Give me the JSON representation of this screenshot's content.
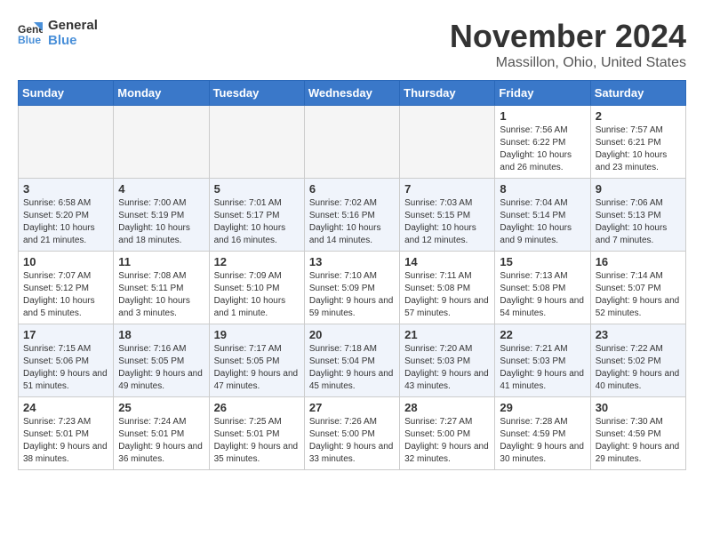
{
  "logo": {
    "line1": "General",
    "line2": "Blue"
  },
  "title": "November 2024",
  "location": "Massillon, Ohio, United States",
  "weekdays": [
    "Sunday",
    "Monday",
    "Tuesday",
    "Wednesday",
    "Thursday",
    "Friday",
    "Saturday"
  ],
  "weeks": [
    [
      {
        "day": "",
        "empty": true
      },
      {
        "day": "",
        "empty": true
      },
      {
        "day": "",
        "empty": true
      },
      {
        "day": "",
        "empty": true
      },
      {
        "day": "",
        "empty": true
      },
      {
        "day": "1",
        "info": "Sunrise: 7:56 AM\nSunset: 6:22 PM\nDaylight: 10 hours and 26 minutes."
      },
      {
        "day": "2",
        "info": "Sunrise: 7:57 AM\nSunset: 6:21 PM\nDaylight: 10 hours and 23 minutes."
      }
    ],
    [
      {
        "day": "3",
        "info": "Sunrise: 6:58 AM\nSunset: 5:20 PM\nDaylight: 10 hours and 21 minutes."
      },
      {
        "day": "4",
        "info": "Sunrise: 7:00 AM\nSunset: 5:19 PM\nDaylight: 10 hours and 18 minutes."
      },
      {
        "day": "5",
        "info": "Sunrise: 7:01 AM\nSunset: 5:17 PM\nDaylight: 10 hours and 16 minutes."
      },
      {
        "day": "6",
        "info": "Sunrise: 7:02 AM\nSunset: 5:16 PM\nDaylight: 10 hours and 14 minutes."
      },
      {
        "day": "7",
        "info": "Sunrise: 7:03 AM\nSunset: 5:15 PM\nDaylight: 10 hours and 12 minutes."
      },
      {
        "day": "8",
        "info": "Sunrise: 7:04 AM\nSunset: 5:14 PM\nDaylight: 10 hours and 9 minutes."
      },
      {
        "day": "9",
        "info": "Sunrise: 7:06 AM\nSunset: 5:13 PM\nDaylight: 10 hours and 7 minutes."
      }
    ],
    [
      {
        "day": "10",
        "info": "Sunrise: 7:07 AM\nSunset: 5:12 PM\nDaylight: 10 hours and 5 minutes."
      },
      {
        "day": "11",
        "info": "Sunrise: 7:08 AM\nSunset: 5:11 PM\nDaylight: 10 hours and 3 minutes."
      },
      {
        "day": "12",
        "info": "Sunrise: 7:09 AM\nSunset: 5:10 PM\nDaylight: 10 hours and 1 minute."
      },
      {
        "day": "13",
        "info": "Sunrise: 7:10 AM\nSunset: 5:09 PM\nDaylight: 9 hours and 59 minutes."
      },
      {
        "day": "14",
        "info": "Sunrise: 7:11 AM\nSunset: 5:08 PM\nDaylight: 9 hours and 57 minutes."
      },
      {
        "day": "15",
        "info": "Sunrise: 7:13 AM\nSunset: 5:08 PM\nDaylight: 9 hours and 54 minutes."
      },
      {
        "day": "16",
        "info": "Sunrise: 7:14 AM\nSunset: 5:07 PM\nDaylight: 9 hours and 52 minutes."
      }
    ],
    [
      {
        "day": "17",
        "info": "Sunrise: 7:15 AM\nSunset: 5:06 PM\nDaylight: 9 hours and 51 minutes."
      },
      {
        "day": "18",
        "info": "Sunrise: 7:16 AM\nSunset: 5:05 PM\nDaylight: 9 hours and 49 minutes."
      },
      {
        "day": "19",
        "info": "Sunrise: 7:17 AM\nSunset: 5:05 PM\nDaylight: 9 hours and 47 minutes."
      },
      {
        "day": "20",
        "info": "Sunrise: 7:18 AM\nSunset: 5:04 PM\nDaylight: 9 hours and 45 minutes."
      },
      {
        "day": "21",
        "info": "Sunrise: 7:20 AM\nSunset: 5:03 PM\nDaylight: 9 hours and 43 minutes."
      },
      {
        "day": "22",
        "info": "Sunrise: 7:21 AM\nSunset: 5:03 PM\nDaylight: 9 hours and 41 minutes."
      },
      {
        "day": "23",
        "info": "Sunrise: 7:22 AM\nSunset: 5:02 PM\nDaylight: 9 hours and 40 minutes."
      }
    ],
    [
      {
        "day": "24",
        "info": "Sunrise: 7:23 AM\nSunset: 5:01 PM\nDaylight: 9 hours and 38 minutes."
      },
      {
        "day": "25",
        "info": "Sunrise: 7:24 AM\nSunset: 5:01 PM\nDaylight: 9 hours and 36 minutes."
      },
      {
        "day": "26",
        "info": "Sunrise: 7:25 AM\nSunset: 5:01 PM\nDaylight: 9 hours and 35 minutes."
      },
      {
        "day": "27",
        "info": "Sunrise: 7:26 AM\nSunset: 5:00 PM\nDaylight: 9 hours and 33 minutes."
      },
      {
        "day": "28",
        "info": "Sunrise: 7:27 AM\nSunset: 5:00 PM\nDaylight: 9 hours and 32 minutes."
      },
      {
        "day": "29",
        "info": "Sunrise: 7:28 AM\nSunset: 4:59 PM\nDaylight: 9 hours and 30 minutes."
      },
      {
        "day": "30",
        "info": "Sunrise: 7:30 AM\nSunset: 4:59 PM\nDaylight: 9 hours and 29 minutes."
      }
    ]
  ]
}
